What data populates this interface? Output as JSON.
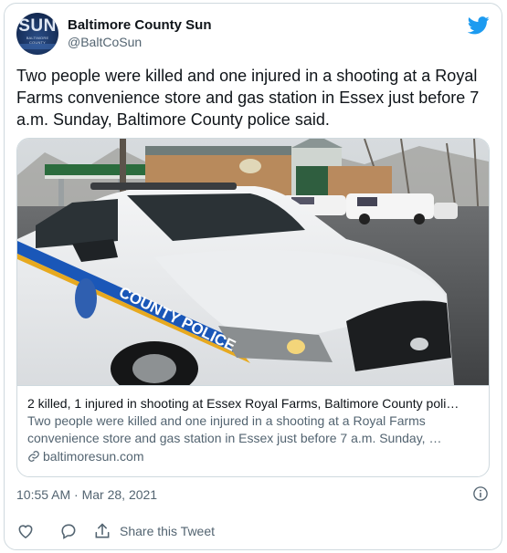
{
  "account": {
    "display_name": "Baltimore County Sun",
    "handle": "@BaltCoSun",
    "avatar_text": "SUN",
    "avatar_subtext": "BALTIMORE COUNTY"
  },
  "tweet": {
    "text": "Two people were killed and one injured in a shooting at a Royal Farms convenience store and gas station in Essex just before 7 a.m. Sunday, Baltimore County police said.",
    "timestamp": "10:55 AM · Mar 28, 2021"
  },
  "card": {
    "title": "2 killed, 1 injured in shooting at Essex Royal Farms, Baltimore County poli…",
    "description": "Two people were killed and one injured in a shooting at a Royal Farms convenience store and gas station in Essex just before 7 a.m. Sunday, …",
    "domain": "baltimoresun.com",
    "image_text": "COUNTY POLICE"
  },
  "actions": {
    "share_label": "Share this Tweet"
  },
  "colors": {
    "twitter_blue": "#1d9bf0",
    "secondary_text": "#536471",
    "border": "#cfd9de"
  },
  "icons": [
    "twitter-bird-icon",
    "heart-icon",
    "reply-icon",
    "share-icon",
    "link-icon",
    "info-icon"
  ]
}
